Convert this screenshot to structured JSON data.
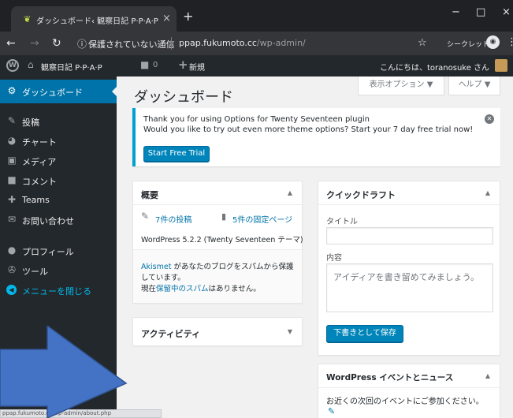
{
  "browser": {
    "tab_title": "ダッシュボード‹ 観察日記 P·P·A·P",
    "tab_close": "×",
    "new_tab": "+",
    "window_controls": [
      "−",
      "□",
      "×"
    ],
    "security_label": "保護されていない通信",
    "url_host": "ppap.fukumoto.cc",
    "url_path": "/wp-admin/",
    "incognito_label": "シークレット"
  },
  "admin_bar": {
    "site_name": "観察日記 P·P·A·P",
    "comment_count": "0",
    "new_label": "新規",
    "greeting": "こんにちは、toranosuke さん"
  },
  "sidebar": {
    "items": [
      {
        "label": "ダッシュボード",
        "icon": "dashboard-icon",
        "glyph": "⚙",
        "active": true
      },
      {
        "label": "投稿",
        "icon": "pin-icon",
        "glyph": "✎"
      },
      {
        "label": "チャート",
        "icon": "chart-icon",
        "glyph": "◕"
      },
      {
        "label": "メディア",
        "icon": "media-icon",
        "glyph": "▣"
      },
      {
        "label": "コメント",
        "icon": "comment-icon",
        "glyph": "■"
      },
      {
        "label": "Teams",
        "icon": "plus-icon",
        "glyph": "✚"
      },
      {
        "label": "お問い合わせ",
        "icon": "mail-icon",
        "glyph": "✉"
      },
      {
        "label": "プロフィール",
        "icon": "user-icon",
        "glyph": "●"
      },
      {
        "label": "ツール",
        "icon": "wrench-icon",
        "glyph": "✇"
      },
      {
        "label": "メニューを閉じる",
        "icon": "collapse-icon",
        "glyph": "◀"
      }
    ]
  },
  "main": {
    "screen_options": "表示オプション ▼",
    "help": "ヘルプ ▼",
    "title": "ダッシュボード",
    "notice": {
      "title": "Thank you for using Options for Twenty Seventeen plugin",
      "text": "Would you like to try out even more theme options? Start your 7 day free trial now!",
      "button": "Start Free Trial"
    },
    "glance": {
      "title": "概要",
      "posts": "7件の投稿",
      "pages": "5件の固定ページ",
      "version": "WordPress 5.2.2 (Twenty Seventeen テーマ)",
      "akismet_link": "Akismet",
      "akismet_text1": " があなたのブログをスパムから保護",
      "akismet_text2": "しています。",
      "spam_prefix": "現在",
      "spam_link": "保留中のスパム",
      "spam_suffix": "はありません。"
    },
    "activity": {
      "title": "アクティビティ"
    },
    "quick_draft": {
      "title": "クイックドラフト",
      "title_label": "タイトル",
      "title_value": "",
      "content_label": "内容",
      "content_placeholder": "アイディアを書き留めてみましょう。",
      "save_button": "下書きとして保存"
    },
    "events": {
      "title": "WordPress イベントとニュース",
      "text": "お近くの次回のイベントにご参加ください。"
    }
  },
  "status_bar": "ppap.fukumoto.cc/wp-admin/about.php",
  "colors": {
    "admin_dark": "#23282d",
    "accent": "#0073aa",
    "notice_border": "#00a0d2",
    "overlay_arrow": "#4472c4"
  }
}
